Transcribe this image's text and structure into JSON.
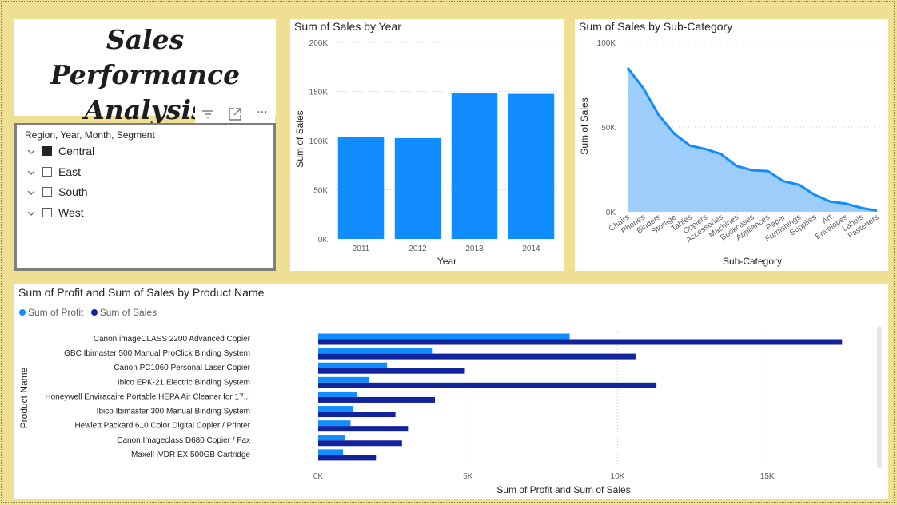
{
  "title": "Sales Performance Analysis",
  "title_lines": [
    "Sales Performance",
    "Analysis"
  ],
  "slicer": {
    "header": "Region, Year, Month, Segment",
    "items": [
      {
        "label": "Central",
        "checked": true
      },
      {
        "label": "East",
        "checked": false
      },
      {
        "label": "South",
        "checked": false
      },
      {
        "label": "West",
        "checked": false
      }
    ]
  },
  "toolbar": {
    "icons": [
      "filter-icon",
      "focus-mode-icon",
      "more-options-icon"
    ],
    "more_label": "···"
  },
  "colors": {
    "light_blue": "#118dff",
    "dark_blue": "#12239e",
    "area_fill": "#9ccdfb",
    "area_line": "#118dff",
    "background": "#efdf94"
  },
  "chart_data": [
    {
      "type": "bar",
      "title": "Sum of Sales by Year",
      "xlabel": "Year",
      "ylabel": "Sum of Sales",
      "categories": [
        "2011",
        "2012",
        "2013",
        "2014"
      ],
      "values": [
        103500,
        102500,
        148000,
        147500
      ],
      "ylim": [
        0,
        200000
      ],
      "yticks": [
        0,
        50000,
        100000,
        150000,
        200000
      ],
      "ytick_labels": [
        "0K",
        "50K",
        "100K",
        "150K",
        "200K"
      ],
      "grid": true
    },
    {
      "type": "area",
      "title": "Sum of Sales by Sub-Category",
      "xlabel": "Sub-Category",
      "ylabel": "Sum of Sales",
      "categories": [
        "Chairs",
        "Phones",
        "Binders",
        "Storage",
        "Tables",
        "Copiers",
        "Accessories",
        "Machines",
        "Bookcases",
        "Appliances",
        "Paper",
        "Furnishings",
        "Supplies",
        "Art",
        "Envelopes",
        "Labels",
        "Fasteners"
      ],
      "values": [
        85000,
        73000,
        57000,
        46000,
        39000,
        37000,
        34000,
        27000,
        24500,
        24000,
        18000,
        16000,
        10000,
        6000,
        4800,
        2300,
        600
      ],
      "ylim": [
        0,
        100000
      ],
      "yticks": [
        0,
        50000,
        100000
      ],
      "ytick_labels": [
        "0K",
        "50K",
        "100K"
      ],
      "grid": true
    },
    {
      "type": "bar",
      "orientation": "horizontal",
      "title": "Sum of Profit and Sum of Sales by Product Name",
      "xlabel": "Sum of Profit and Sum of Sales",
      "ylabel": "Product Name",
      "categories": [
        "Canon imageCLASS 2200 Advanced Copier",
        "GBC Ibimaster 500 Manual ProClick Binding System",
        "Canon PC1060 Personal Laser Copier",
        "Ibico EPK-21 Electric Binding System",
        "Honeywell Enviracaire Portable HEPA Air Cleaner for 17...",
        "Ibico Ibimaster 300 Manual Binding System",
        "Hewlett Packard 610 Color Digital Copier / Printer",
        "Canon Imageclass D680 Copier / Fax",
        "Maxell iVDR EX 500GB Cartridge"
      ],
      "series": [
        {
          "name": "Sum of Profit",
          "values": [
            8400,
            3800,
            2300,
            1700,
            1300,
            1150,
            1080,
            880,
            830
          ]
        },
        {
          "name": "Sum of Sales",
          "values": [
            17500,
            10600,
            4900,
            11300,
            3900,
            2580,
            3000,
            2800,
            1930
          ]
        }
      ],
      "xlim": [
        0,
        18000
      ],
      "xticks": [
        0,
        5000,
        10000,
        15000
      ],
      "xtick_labels": [
        "0K",
        "5K",
        "10K",
        "15K"
      ],
      "legend": "top-left",
      "grid": true
    }
  ]
}
